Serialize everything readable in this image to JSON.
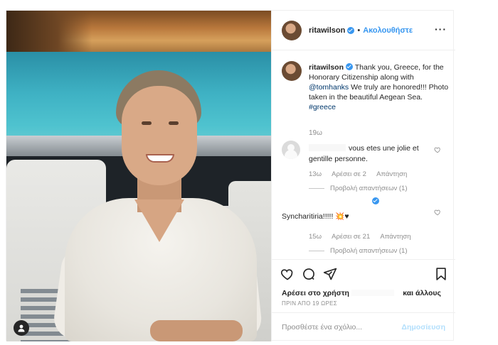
{
  "header": {
    "username": "ritawilson",
    "separator": "•",
    "follow_label": "Ακολουθήστε",
    "more_label": "···"
  },
  "caption": {
    "username": "ritawilson",
    "text_before_mention": " Thank you, Greece, for the Honorary Citizenship along with ",
    "mention": "@tomhanks",
    "text_after_mention": " We truly are honored!!! Photo taken in the beautiful Aegean Sea. ",
    "hashtag": "#greece",
    "time": "19ω"
  },
  "comments": [
    {
      "text": "vous etes une jolie et gentille personne.",
      "time": "13ω",
      "likes": "Αρέσει σε 2",
      "reply_label": "Απάντηση",
      "view_replies": "Προβολή απαντήσεων (1)"
    },
    {
      "text": "Syncharitiria!!!!!",
      "emoji_1": "💥",
      "emoji_2": "♥",
      "time": "15ω",
      "likes": "Αρέσει σε 21",
      "reply_label": "Απάντηση",
      "view_replies": "Προβολή απαντήσεων (1)"
    }
  ],
  "actions": {
    "icons": [
      "heart-icon",
      "comment-icon",
      "share-icon",
      "bookmark-icon"
    ]
  },
  "likes": {
    "prefix": "Αρέσει στο χρήστη",
    "suffix": "και άλλους"
  },
  "timestamp": "ΠΡΙΝ ΑΠΟ 19 ΩΡΕΣ",
  "add_comment": {
    "placeholder": "Προσθέστε ένα σχόλιο...",
    "post_label": "Δημοσίευση"
  },
  "colors": {
    "accent": "#3897f0",
    "post_disabled": "#b2dffc",
    "muted": "#8e8e8e"
  }
}
